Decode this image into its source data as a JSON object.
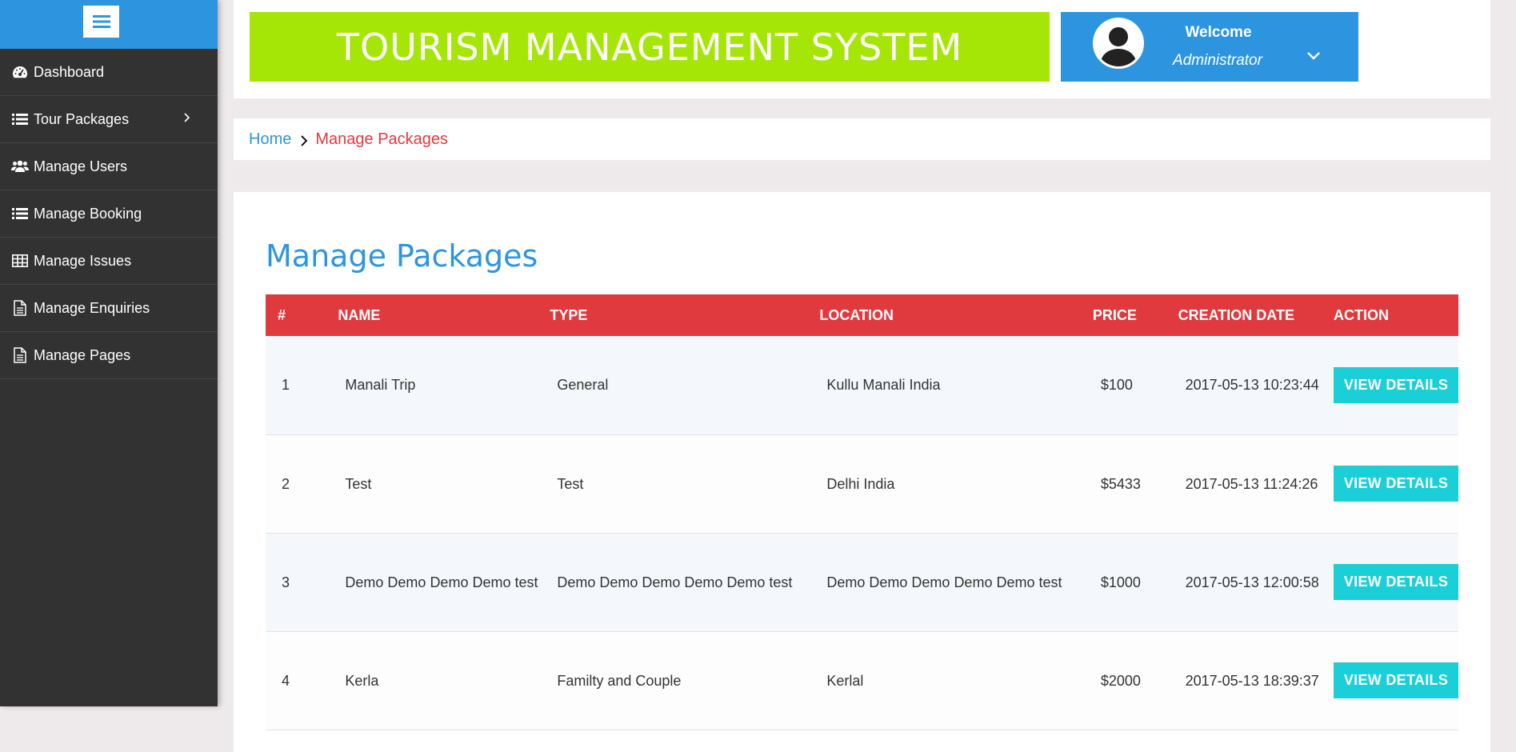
{
  "sidebar": {
    "items": [
      {
        "label": "Dashboard",
        "icon": "dashboard-icon"
      },
      {
        "label": "Tour Packages",
        "icon": "list-icon",
        "has_submenu": true
      },
      {
        "label": "Manage Users",
        "icon": "users-icon"
      },
      {
        "label": "Manage Booking",
        "icon": "list-icon"
      },
      {
        "label": "Manage Issues",
        "icon": "table-icon"
      },
      {
        "label": "Manage Enquiries",
        "icon": "document-icon"
      },
      {
        "label": "Manage Pages",
        "icon": "document-icon"
      }
    ]
  },
  "header": {
    "title": "TOURISM MANAGEMENT SYSTEM",
    "welcome": "Welcome",
    "role": "Administrator"
  },
  "breadcrumb": {
    "home": "Home",
    "current": "Manage Packages"
  },
  "main": {
    "title": "Manage Packages",
    "columns": [
      "#",
      "NAME",
      "TYPE",
      "LOCATION",
      "PRICE",
      "CREATION DATE",
      "ACTION"
    ],
    "rows": [
      {
        "num": "1",
        "name": "Manali Trip",
        "type": "General",
        "location": "Kullu Manali India",
        "price": "$100",
        "date": "2017-05-13 10:23:44",
        "action": "VIEW DETAILS"
      },
      {
        "num": "2",
        "name": "Test",
        "type": "Test",
        "location": "Delhi India",
        "price": "$5433",
        "date": "2017-05-13 11:24:26",
        "action": "VIEW DETAILS"
      },
      {
        "num": "3",
        "name": "Demo Demo Demo Demo test",
        "type": "Demo Demo Demo Demo Demo test",
        "location": "Demo Demo Demo Demo Demo test",
        "price": "$1000",
        "date": "2017-05-13 12:00:58",
        "action": "VIEW DETAILS"
      },
      {
        "num": "4",
        "name": "Kerla",
        "type": "Familty and Couple",
        "location": "Kerlal",
        "price": "$2000",
        "date": "2017-05-13 18:39:37",
        "action": "VIEW DETAILS"
      }
    ]
  },
  "colors": {
    "sidebar_bg": "#333233",
    "accent_blue": "#2d95df",
    "title_green": "#a5e607",
    "table_header_red": "#e0393e",
    "button_cyan": "#1bcfd9"
  }
}
